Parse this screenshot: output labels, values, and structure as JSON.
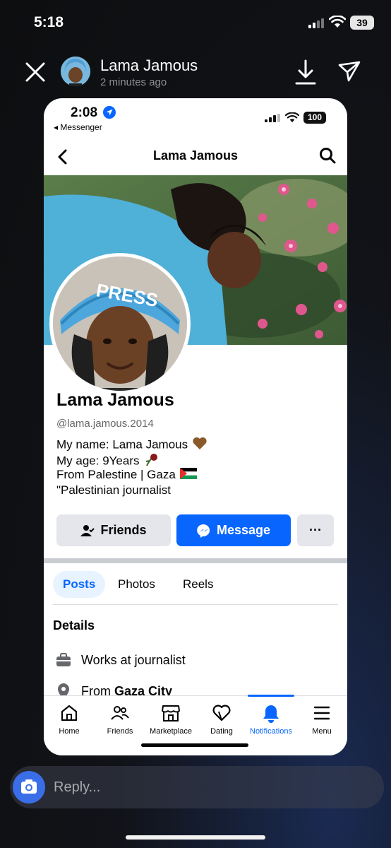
{
  "os_status": {
    "time": "5:18",
    "battery": "39"
  },
  "story": {
    "name": "Lama Jamous",
    "time_ago": "2 minutes ago"
  },
  "inner": {
    "status": {
      "time": "2:08",
      "back_app": "◂ Messenger",
      "battery": "100"
    },
    "header": {
      "title": "Lama Jamous"
    },
    "profile": {
      "name": "Lama Jamous",
      "handle": "@lama.jamous.2014",
      "bio": [
        "My name: Lama Jamous",
        "My age: 9Years",
        "From Palestine | Gaza",
        "\"Palestinian journalist"
      ],
      "avatar_badge": "PRESS"
    },
    "buttons": {
      "friends": "Friends",
      "message": "Message",
      "more": "···"
    },
    "tabs": [
      "Posts",
      "Photos",
      "Reels"
    ],
    "details": {
      "title": "Details",
      "work": "Works at journalist",
      "from_prefix": "From ",
      "from_place": "Gaza City"
    },
    "nav": [
      {
        "label": "Home",
        "icon": "home-icon"
      },
      {
        "label": "Friends",
        "icon": "friends-icon"
      },
      {
        "label": "Marketplace",
        "icon": "marketplace-icon"
      },
      {
        "label": "Dating",
        "icon": "dating-icon"
      },
      {
        "label": "Notifications",
        "icon": "bell-icon"
      },
      {
        "label": "Menu",
        "icon": "menu-icon"
      }
    ],
    "colors": {
      "accent": "#0866ff",
      "button_gray": "#e4e6eb"
    }
  },
  "reply": {
    "placeholder": "Reply..."
  }
}
